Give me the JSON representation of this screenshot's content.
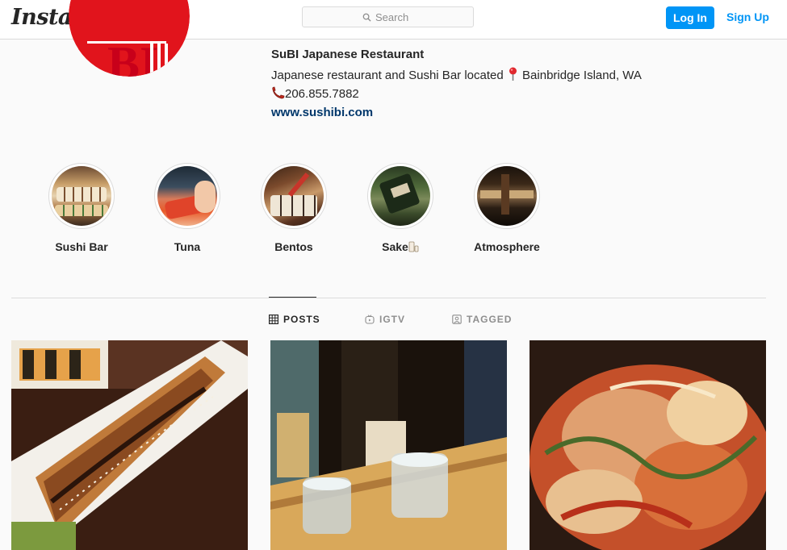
{
  "header": {
    "logo_text": "Instagram",
    "search_placeholder": "Search",
    "login_label": "Log In",
    "signup_label": "Sign Up",
    "accent_color": "#0095f6"
  },
  "profile": {
    "avatar_letters": "BI",
    "name": "SuBI Japanese Restaurant",
    "bio_line1": "Japanese restaurant and Sushi Bar located",
    "bio_location": "Bainbridge Island, WA",
    "phone": "206.855.7882",
    "website": "www.sushibi.com"
  },
  "highlights": [
    {
      "label": "Sushi Bar"
    },
    {
      "label": "Tuna"
    },
    {
      "label": "Bentos"
    },
    {
      "label": "Sake"
    },
    {
      "label": "Atmosphere"
    }
  ],
  "tabs": [
    {
      "label": "POSTS",
      "icon": "grid-icon",
      "active": true
    },
    {
      "label": "IGTV",
      "icon": "igtv-icon",
      "active": false
    },
    {
      "label": "TAGGED",
      "icon": "tagged-icon",
      "active": false
    }
  ]
}
